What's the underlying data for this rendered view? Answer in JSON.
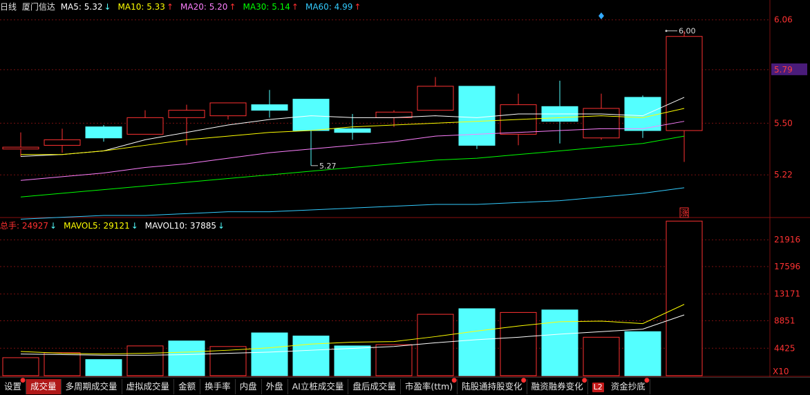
{
  "price_header": {
    "period": "日线",
    "stock_name": "厦门信达",
    "indicators": [
      {
        "label": "MA5: 5.32",
        "arrow": "↓",
        "color": "#ffffff"
      },
      {
        "label": "MA10: 5.33",
        "arrow": "↑",
        "color": "#ffff00"
      },
      {
        "label": "MA20: 5.20",
        "arrow": "↑",
        "color": "#ff80ff"
      },
      {
        "label": "MA30: 5.14",
        "arrow": "↑",
        "color": "#00ff00"
      },
      {
        "label": "MA60: 4.99",
        "arrow": "↑",
        "color": "#33ccff"
      }
    ]
  },
  "volume_header": {
    "indicators": [
      {
        "label": "总手: 24927",
        "arrow": "↓",
        "color": "#ff3030"
      },
      {
        "label": "MAVOL5: 29121",
        "arrow": "↓",
        "color": "#ffff00"
      },
      {
        "label": "MAVOL10: 37885",
        "arrow": "↓",
        "color": "#ffffff"
      }
    ]
  },
  "price_axis": {
    "ticks": [
      "6.06",
      "5.79",
      "5.50",
      "5.22"
    ],
    "current": "5.79"
  },
  "volume_axis": {
    "ticks": [
      "21916",
      "17596",
      "13171",
      "8851",
      "4425"
    ],
    "unit": "X10"
  },
  "annotations": {
    "high": "6.00",
    "low": "5.27",
    "limit_up_marker": "涨"
  },
  "tabs": [
    {
      "label": "设置",
      "dot": true
    },
    {
      "label": "成交量",
      "dot": false,
      "active": true
    },
    {
      "label": "多周期成交量",
      "dot": false
    },
    {
      "label": "虚拟成交量",
      "dot": false
    },
    {
      "label": "金额",
      "dot": false
    },
    {
      "label": "换手率",
      "dot": false
    },
    {
      "label": "内盘",
      "dot": false
    },
    {
      "label": "外盘",
      "dot": false
    },
    {
      "label": "AI立桩成交量",
      "dot": false
    },
    {
      "label": "盘后成交量",
      "dot": false
    },
    {
      "label": "市盈率(ttm)",
      "dot": true
    },
    {
      "label": "陆股通持股变化",
      "dot": true
    },
    {
      "label": "融资融券变化",
      "dot": true
    },
    {
      "label": "L2",
      "dot": false,
      "badge": true
    },
    {
      "label": "资金抄底",
      "dot": true
    }
  ],
  "colors": {
    "up": "#ff3232",
    "down": "#54ffff",
    "grid": "#7a1010"
  },
  "chart_data": [
    {
      "type": "candlestick",
      "title": "",
      "ylim": [
        5.0,
        6.1
      ],
      "candles": [
        {
          "open": 5.36,
          "close": 5.37,
          "high": 5.45,
          "low": 5.32
        },
        {
          "open": 5.38,
          "close": 5.41,
          "high": 5.47,
          "low": 5.34
        },
        {
          "open": 5.48,
          "close": 5.42,
          "high": 5.49,
          "low": 5.4
        },
        {
          "open": 5.44,
          "close": 5.53,
          "high": 5.57,
          "low": 5.44
        },
        {
          "open": 5.53,
          "close": 5.57,
          "high": 5.6,
          "low": 5.38
        },
        {
          "open": 5.54,
          "close": 5.61,
          "high": 5.61,
          "low": 5.52
        },
        {
          "open": 5.6,
          "close": 5.57,
          "high": 5.68,
          "low": 5.53
        },
        {
          "open": 5.63,
          "close": 5.46,
          "high": 5.63,
          "low": 5.27
        },
        {
          "open": 5.47,
          "close": 5.45,
          "high": 5.55,
          "low": 5.41
        },
        {
          "open": 5.53,
          "close": 5.56,
          "high": 5.57,
          "low": 5.48
        },
        {
          "open": 5.57,
          "close": 5.7,
          "high": 5.75,
          "low": 5.57
        },
        {
          "open": 5.7,
          "close": 5.38,
          "high": 5.7,
          "low": 5.36
        },
        {
          "open": 5.44,
          "close": 5.6,
          "high": 5.66,
          "low": 5.38
        },
        {
          "open": 5.59,
          "close": 5.51,
          "high": 5.73,
          "low": 5.39
        },
        {
          "open": 5.42,
          "close": 5.58,
          "high": 5.66,
          "low": 5.41
        },
        {
          "open": 5.64,
          "close": 5.46,
          "high": 5.65,
          "low": 5.42
        },
        {
          "open": 5.46,
          "close": 5.97,
          "high": 6.0,
          "low": 5.29
        }
      ],
      "ma_series": [
        {
          "name": "MA5",
          "color": "#ffffff",
          "values": [
            5.32,
            5.33,
            5.35,
            5.41,
            5.45,
            5.49,
            5.52,
            5.54,
            5.53,
            5.53,
            5.54,
            5.53,
            5.55,
            5.55,
            5.55,
            5.54,
            5.64
          ]
        },
        {
          "name": "MA10",
          "color": "#ffff00",
          "values": [
            5.33,
            5.33,
            5.35,
            5.38,
            5.41,
            5.43,
            5.45,
            5.46,
            5.48,
            5.49,
            5.5,
            5.51,
            5.52,
            5.53,
            5.54,
            5.53,
            5.58
          ]
        },
        {
          "name": "MA20",
          "color": "#ff80ff",
          "values": [
            5.19,
            5.21,
            5.23,
            5.26,
            5.28,
            5.31,
            5.34,
            5.36,
            5.38,
            5.4,
            5.43,
            5.44,
            5.45,
            5.46,
            5.47,
            5.47,
            5.51
          ]
        },
        {
          "name": "MA30",
          "color": "#00ff00",
          "values": [
            5.1,
            5.12,
            5.14,
            5.16,
            5.18,
            5.2,
            5.22,
            5.24,
            5.26,
            5.28,
            5.3,
            5.31,
            5.33,
            5.35,
            5.37,
            5.39,
            5.43
          ]
        },
        {
          "name": "MA60",
          "color": "#33ccff",
          "values": [
            4.98,
            4.99,
            5.0,
            5.0,
            5.01,
            5.02,
            5.02,
            5.03,
            5.04,
            5.05,
            5.06,
            5.06,
            5.07,
            5.08,
            5.1,
            5.12,
            5.15
          ]
        }
      ]
    },
    {
      "type": "bar",
      "title": "",
      "ylim": [
        0,
        23500
      ],
      "values": [
        2900,
        3700,
        2600,
        4800,
        5600,
        4700,
        6900,
        6400,
        4800,
        5000,
        9900,
        10800,
        10200,
        10600,
        6200,
        7100,
        24927
      ],
      "up": [
        true,
        true,
        false,
        true,
        false,
        true,
        false,
        false,
        false,
        true,
        true,
        false,
        true,
        false,
        true,
        false,
        true
      ],
      "series": [
        {
          "name": "MAVOL5",
          "color": "#ffff00",
          "values": [
            3900,
            3600,
            3500,
            3600,
            3800,
            4100,
            4500,
            5100,
            5400,
            5500,
            6300,
            7200,
            8000,
            8700,
            8800,
            8400,
            11500
          ]
        },
        {
          "name": "MAVOL10",
          "color": "#ffffff",
          "values": [
            3500,
            3400,
            3300,
            3300,
            3400,
            3600,
            3800,
            4100,
            4400,
            4700,
            5300,
            5800,
            6200,
            6700,
            7100,
            7500,
            9800
          ]
        }
      ]
    }
  ]
}
